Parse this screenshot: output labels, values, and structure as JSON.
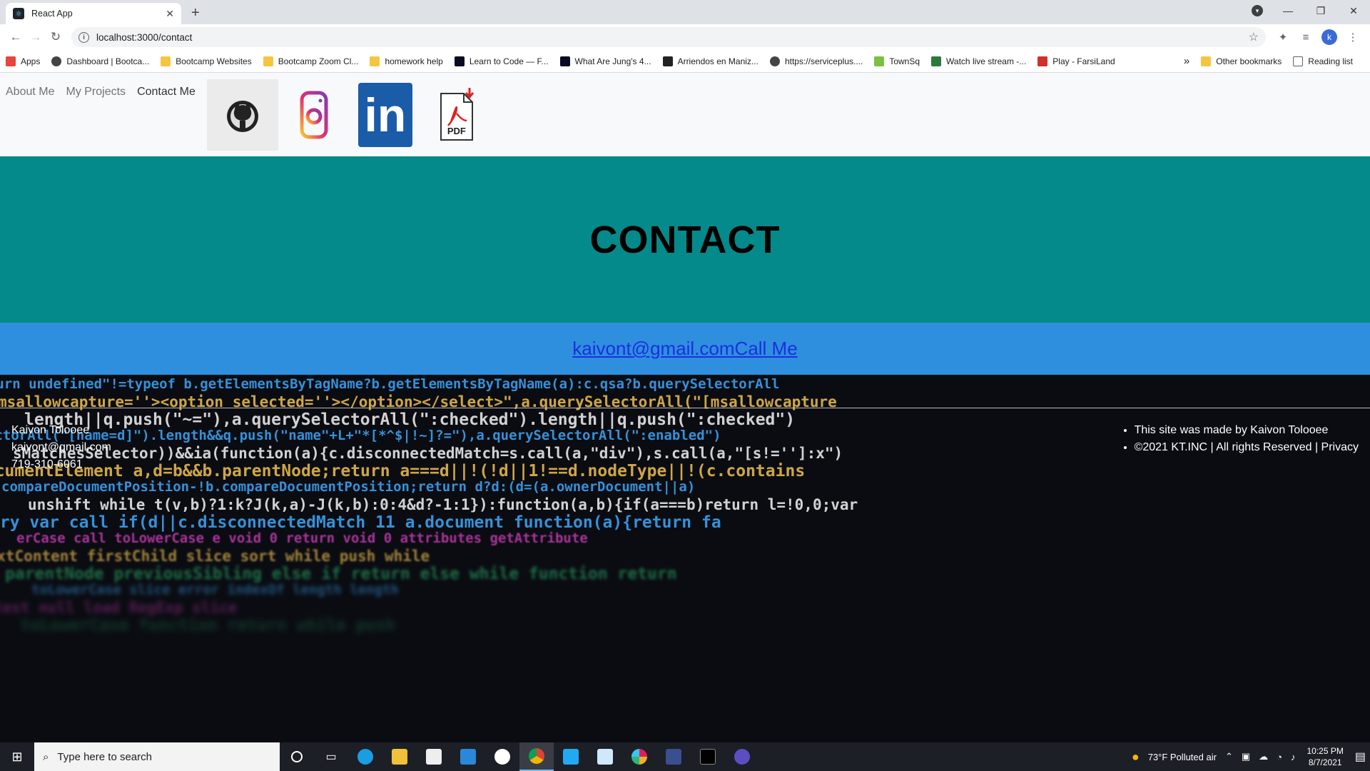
{
  "browser": {
    "tab_title": "React App",
    "new_tab": "+",
    "url": "localhost:3000/contact",
    "profile_initial": "k",
    "bookmarks": [
      {
        "label": "Apps",
        "icon": "apps-grid-icon",
        "color": "#e8453c"
      },
      {
        "label": "Dashboard | Bootca...",
        "icon": "globe-icon",
        "color": "#444444"
      },
      {
        "label": "Bootcamp Websites",
        "icon": "folder-icon",
        "color": "#f5c542"
      },
      {
        "label": "Bootcamp Zoom Cl...",
        "icon": "folder-icon",
        "color": "#f5c542"
      },
      {
        "label": "homework help",
        "icon": "folder-icon",
        "color": "#f5c542"
      },
      {
        "label": "Learn to Code — F...",
        "icon": "freecodecamp-icon",
        "color": "#0a0a23"
      },
      {
        "label": "What Are Jung's 4...",
        "icon": "w-icon",
        "color": "#0a0a23"
      },
      {
        "label": "Arriendos en Maniz...",
        "icon": "fr-icon",
        "color": "#222222"
      },
      {
        "label": "https://serviceplus....",
        "icon": "globe-icon",
        "color": "#444444"
      },
      {
        "label": "TownSq",
        "icon": "townsq-icon",
        "color": "#7ac143"
      },
      {
        "label": "Watch live stream -...",
        "icon": "tr-icon",
        "color": "#2a7a3b"
      },
      {
        "label": "Play - FarsiLand",
        "icon": "farsiland-icon",
        "color": "#d0312d"
      }
    ],
    "bookmarks_overflow": "»",
    "other_bookmarks": "Other bookmarks",
    "reading_list": "Reading list"
  },
  "navbar": {
    "links": [
      "About Me",
      "My Projects",
      "Contact Me"
    ],
    "social": [
      "github-icon",
      "instagram-icon",
      "linkedin-icon",
      "pdf-resume-icon"
    ],
    "linkedin_text": "in",
    "pdf_text": "PDF"
  },
  "hero": {
    "title": "CONTACT"
  },
  "contact": {
    "email_link": "kaivont@gmail.com",
    "call_link": "Call Me"
  },
  "footer": {
    "name": "Kaivon Tolooee",
    "email": "kaivont@gmail.com",
    "phone": "719-310-6061",
    "right_items": [
      "This site was made by Kaivon Tolooee",
      "©2021 KT.INC | All rights Reserved | Privacy"
    ]
  },
  "taskbar": {
    "search_placeholder": "Type here to search",
    "weather": "73°F  Polluted air",
    "time": "10:25 PM",
    "date": "8/7/2021"
  }
}
